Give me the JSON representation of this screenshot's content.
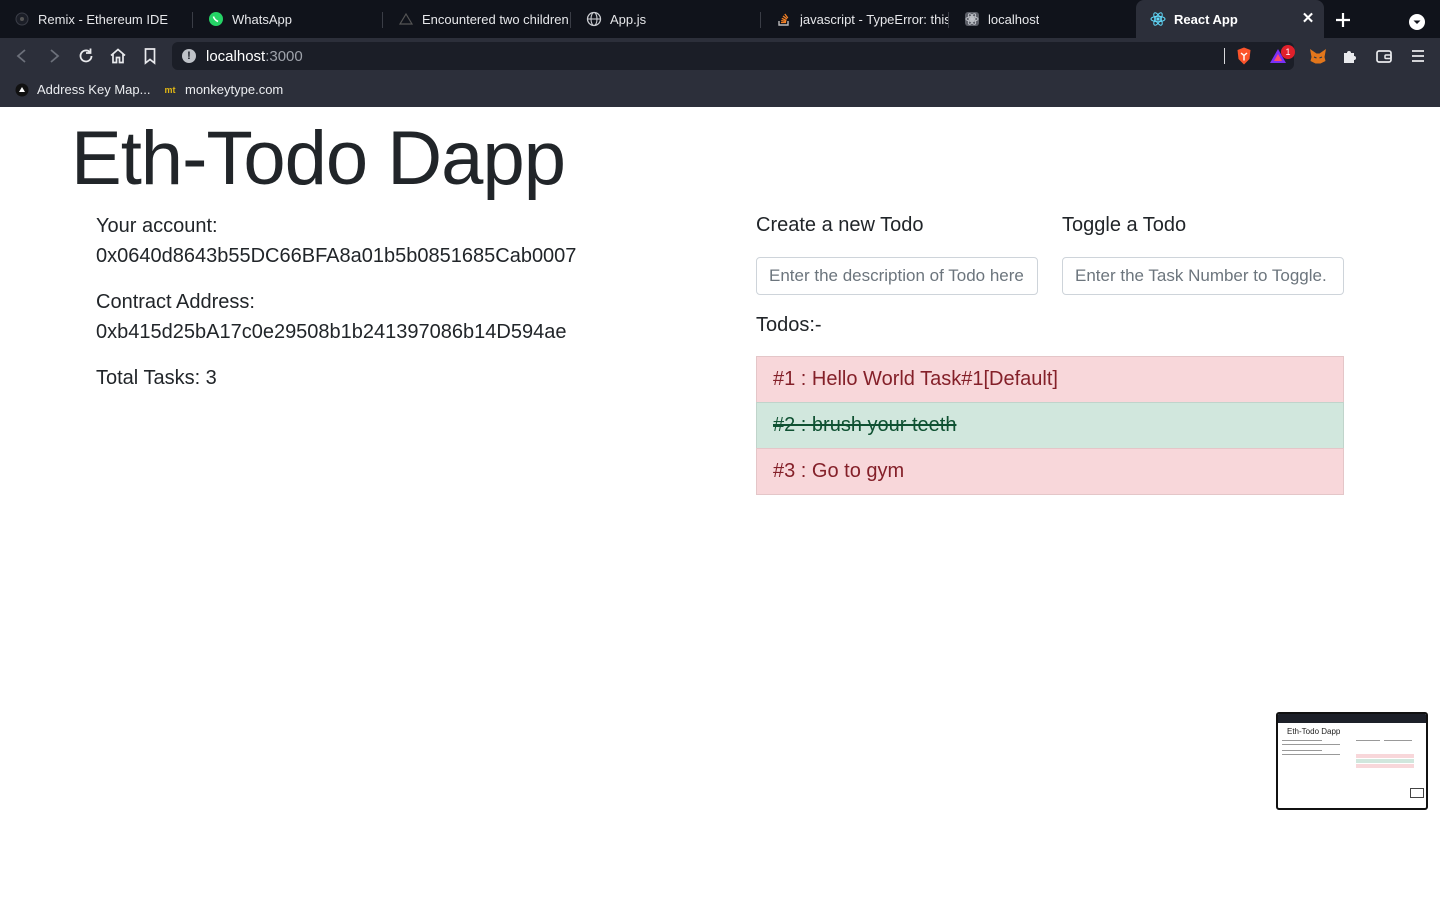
{
  "browser": {
    "tabs": [
      {
        "title": "Remix - Ethereum IDE",
        "icon": "remix-icon"
      },
      {
        "title": "WhatsApp",
        "icon": "whatsapp-icon"
      },
      {
        "title": "Encountered two children w",
        "icon": "vercel-icon"
      },
      {
        "title": "App.js",
        "icon": "globe-icon"
      },
      {
        "title": "javascript - TypeError: this",
        "icon": "stackoverflow-icon"
      },
      {
        "title": "localhost",
        "icon": "localhost-icon"
      },
      {
        "title": "React App",
        "icon": "react-icon"
      }
    ],
    "active_tab_index": 6,
    "url_host": "localhost",
    "url_port": ":3000",
    "notification_badge": "1",
    "bookmarks": [
      {
        "label": "Address Key Map...",
        "icon": "bookmark-site-icon"
      },
      {
        "label": "monkeytype.com",
        "icon": "monkeytype-icon"
      }
    ],
    "colors": {
      "tabstrip": "#10131b",
      "toolbar": "#2c2f3a",
      "brave": "#fb542b"
    }
  },
  "app": {
    "title": "Eth-Todo Dapp",
    "account_label": "Your account:",
    "account_value": "0x0640d8643b55DC66BFA8a01b5b0851685Cab0007",
    "contract_label": "Contract Address:",
    "contract_value": "0xb415d25bA17c0e29508b1b241397086b14D594ae",
    "total_tasks": "Total Tasks: 3",
    "create_label": "Create a new Todo",
    "create_placeholder": "Enter the description of Todo here..",
    "toggle_label": "Toggle a Todo",
    "toggle_placeholder": "Enter the Task Number to Toggle.",
    "todos_label": "Todos:-",
    "todos": [
      {
        "text": "#1 : Hello World Task#1[Default]",
        "completed": false
      },
      {
        "text": "#2 : brush your teeth",
        "completed": true
      },
      {
        "text": "#3 : Go to gym",
        "completed": false
      }
    ],
    "colors": {
      "pending_bg": "#f8d7da",
      "pending_text": "#842029",
      "done_bg": "#d1e7dd",
      "done_text": "#0f5132"
    }
  },
  "preview": {
    "title": "Eth-Todo Dapp"
  }
}
